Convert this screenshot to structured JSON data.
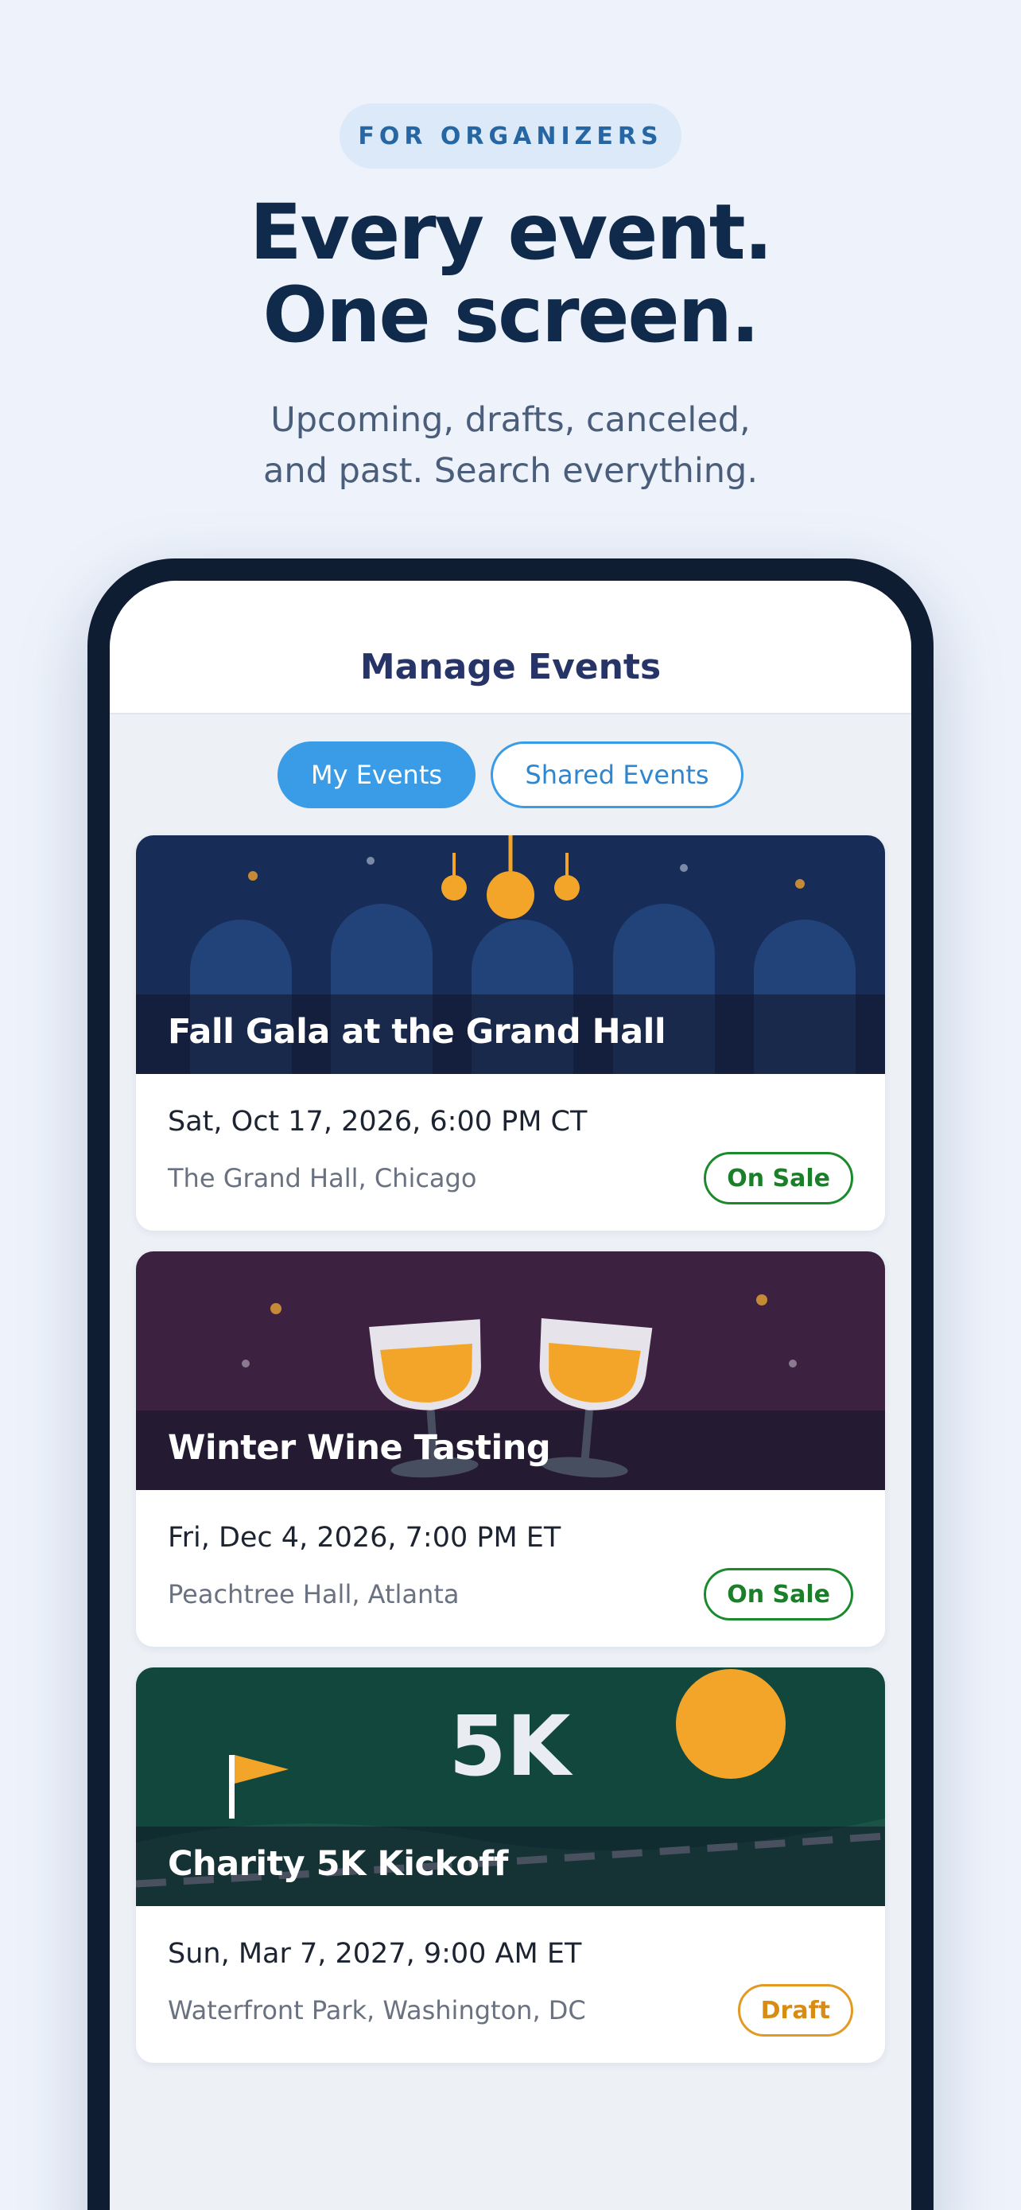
{
  "hero": {
    "pill": "FOR ORGANIZERS",
    "headline": [
      "Every event.",
      "One screen."
    ],
    "subhead": [
      "Upcoming, drafts, canceled,",
      "and past. Search everything."
    ]
  },
  "app": {
    "title": "Manage Events",
    "tabs": [
      {
        "label": "My Events",
        "active": true
      },
      {
        "label": "Shared Events",
        "active": false
      }
    ]
  },
  "events": [
    {
      "title": "Fall Gala at the Grand Hall",
      "date": "Sat, Oct 17, 2026, 6:00 PM CT",
      "venue": "The Grand Hall, Chicago",
      "status": "On Sale",
      "banner": "chandelier-arches-illustration"
    },
    {
      "title": "Winter Wine Tasting",
      "date": "Fri, Dec 4, 2026, 7:00 PM ET",
      "venue": "Peachtree Hall, Atlanta",
      "status": "On Sale",
      "banner": "wine-glasses-illustration"
    },
    {
      "title": "Charity 5K Kickoff",
      "date": "Sun, Mar 7, 2027, 9:00 AM ET",
      "venue": "Waterfront Park, Washington, DC",
      "status": "Draft",
      "banner": "race-flag-sun-illustration",
      "banner_text": "5K"
    }
  ],
  "colors": {
    "accent": "#3a9ce6",
    "on_sale": "#1a8a2c",
    "draft": "#e29a22",
    "gala_bg": "#172c57",
    "wine_bg": "#3d2140",
    "race_bg": "#12473e"
  }
}
